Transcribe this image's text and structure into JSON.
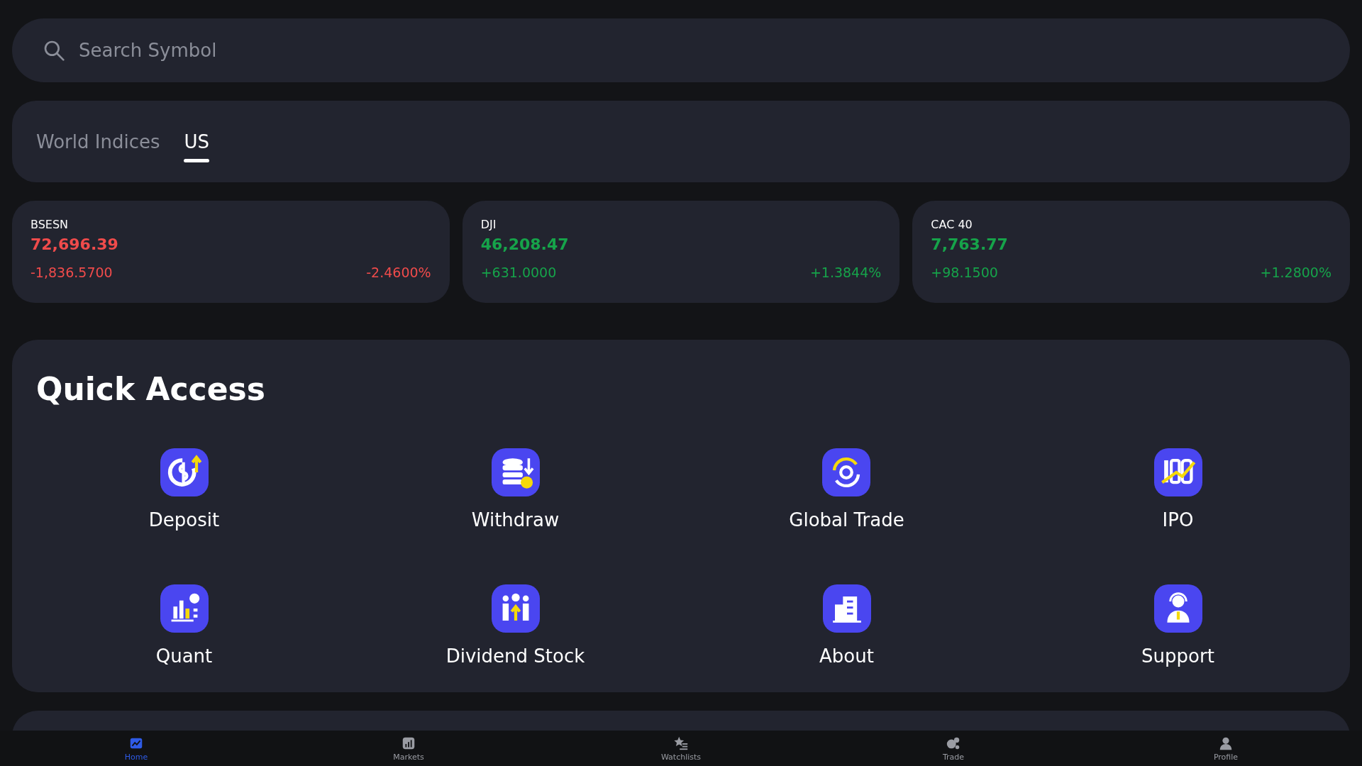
{
  "search": {
    "placeholder": "Search Symbol"
  },
  "tabs": [
    {
      "label": "World Indices",
      "selected": false
    },
    {
      "label": "US",
      "selected": true
    }
  ],
  "indices": [
    {
      "name": "BSESN",
      "value": "72,696.39",
      "change": "-1,836.5700",
      "percent": "-2.4600%",
      "color": "#f04b4b"
    },
    {
      "name": "DJI",
      "value": "46,208.47",
      "change": "+631.0000",
      "percent": "+1.3844%",
      "color": "#16a34a"
    },
    {
      "name": "CAC 40",
      "value": "7,763.77",
      "change": "+98.1500",
      "percent": "+1.2800%",
      "color": "#16a34a"
    }
  ],
  "quick_access": {
    "title": "Quick Access",
    "items": [
      {
        "label": "Deposit"
      },
      {
        "label": "Withdraw"
      },
      {
        "label": "Global Trade"
      },
      {
        "label": "IPO"
      },
      {
        "label": "Quant"
      },
      {
        "label": "Dividend Stock"
      },
      {
        "label": "About"
      },
      {
        "label": "Support"
      }
    ]
  },
  "bottom_nav": [
    {
      "label": "Home",
      "selected": true
    },
    {
      "label": "Markets",
      "selected": false
    },
    {
      "label": "Watchlists",
      "selected": false
    },
    {
      "label": "Trade",
      "selected": false
    },
    {
      "label": "Profile",
      "selected": false
    }
  ]
}
